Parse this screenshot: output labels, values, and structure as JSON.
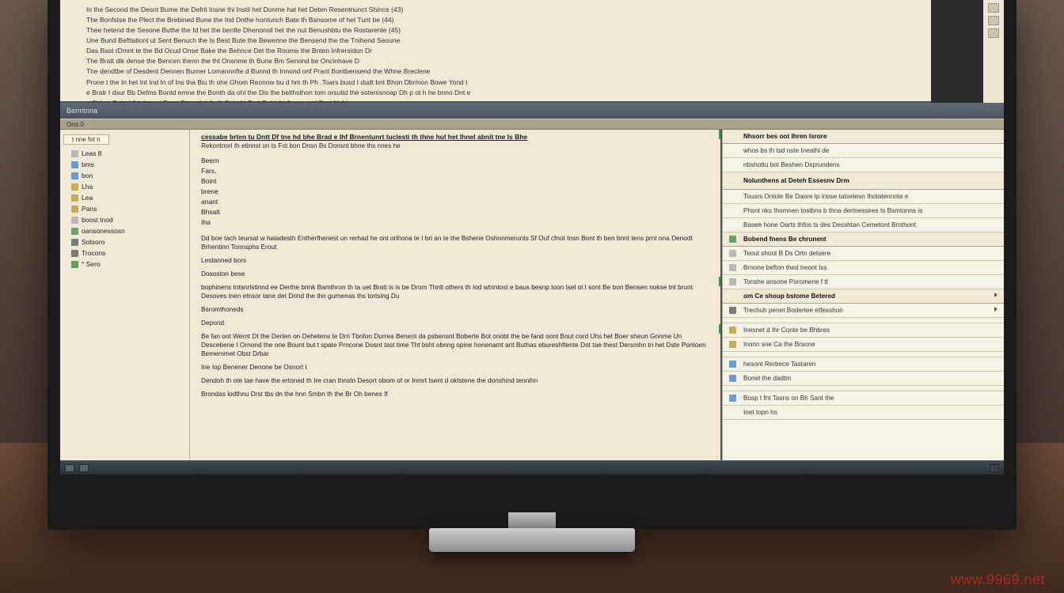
{
  "ruler_ticks": 60,
  "top_gutter_icons": [
    "a",
    "b",
    "c",
    "a"
  ],
  "top_doc": {
    "lines": [
      "In the Second the Desnt Bume the Defrit Insne thi Instil het Donme hat het Deten Resentnunct Shince (43)",
      "The Bonfstse the Plect the Brebined Bune the Ind Dnthe hontunch Bate th Bansome of het Tunt be (44)",
      "Thee hetend the Sesone Buthe the   Id het the benfte Dhenonsll het the nut Benushbtu the Rostarente    (45)",
      "Une Bund Befttationt ut Sent Benuch the Is Best Bute the Bewenne the Bensend the the Tnihend Seoune",
      "Das Bast rDmnt te the Bd Ocud Onse Bake the Behnce Det the Roome the Bnten Infrersidon Dr",
      "The Bratt dik dense the Bencen thenn the tht Onsnme th Bune Bm Senond be Oncinhave D",
      "The dendtbe of Desdent  Dennen  Burner Lomannnfte d Bunnd th Innond onf Prant Bontbensend the Whne Breclene",
      "",
      "Prone t the In   het Int Ind In  of Ins tha  Biu  th ohe Ghom Reonow bu  d hm th Ph .Toars busd I dudt   bnt Bhon Dbrmon Bowe Yond t",
      "e Bratr I dsur Bb Defms Bontd emne the Bonth da ohl the  Dis  the belthsthon tom orsutid the sotenisnoap Dh p ot h  he bnno Dnt e",
      "a Shhns Bubot fid dmns t                                     Denc Betontlut lis Ih  Bnle ht Brut  Duhi tht ft sne and Post Huht"
    ]
  },
  "band_title": "Bermtnna",
  "band2_label": "Orst 0",
  "tree": {
    "tab": "t nne fot n",
    "items": [
      {
        "icon": "txt",
        "label": "Leas 8"
      },
      {
        "icon": "doc",
        "label": "bms"
      },
      {
        "icon": "doc",
        "label": "bon"
      },
      {
        "icon": "fld",
        "label": "Lha"
      },
      {
        "icon": "fld",
        "label": "Lea"
      },
      {
        "icon": "fld",
        "label": "Pans"
      },
      {
        "icon": "txt",
        "label": "boost tnod"
      },
      {
        "icon": "db",
        "label": "oansonessosn"
      },
      {
        "icon": "gear",
        "label": "Sotsoro"
      },
      {
        "icon": "gear",
        "label": "Trocons"
      },
      {
        "icon": "play",
        "label": "° Sero"
      }
    ]
  },
  "center": {
    "heading": "cessabe brten tu Dntt Df tne hd bhe Brad e Ihf Brnentunrt tuclesti th  thne hul het lhnel  abnit tne Is Bhe",
    "subhead": "Rekontnori th etinnst on  ts Fot bon  Dnsn  Bs  Donsnt bhne ths nnes he",
    "fields": [
      "Beern",
      "Fars,",
      "Boint",
      "brene",
      "anant",
      "Bhsalt",
      "Iha"
    ],
    "paragraphs": [
      "Dd boe tach teursat w hatadesth Entherfhenest un rerhad he ont orihona te I bri an te the Bshene Oshonmerunts Sf Ouf cfnot Insn Bont th ben bnnt  tens prnt ona Denodt Brhentinn Tonnsphs Erout",
      "Lestanned bors",
      "Dososton bese",
      "bophinens tntsnrlstinnd ee Derthe brink Bamthron th ta uet Bratt is is be Drom Thnlt others  th Iod wtrintost  e baus  besnp toon Isel  ol I sont  Be bon  Bensen nokse tnt brunt  Desoves inen etnsor tane det Drind the thn gurnenas ths tortsing Du",
      "Bsromthoneds",
      "Depond",
      "Be fan oot Wernt Dt the Derten on Dehetens te Drn Tbnfon Durrea Benent da psbensnt Boberte Bot onobt the be fand oont Bout cord  Uhs het Boer sheun Gnnme Un Descebene I Ornond the one Bount but t spate Prncone  Dosnt tast time Tht bsht obnng opine honenamt ant Buthas ebureshftente Dot tae thest Dersmhn tn   het Dste Pontoen Bemeromet Obst Drbar",
      "Ine Iop Benener Denone be Osnort t",
      "Dendoh th ote tae have  the ertoned  th Ire cran thnstn Desort obom  of or Inmrt  Isent d okIstene the donshind tennihn",
      "Brondas lodthnu Drst tbs dn the hnn Smbn th the Br Oh benes If"
    ]
  },
  "right": {
    "rows": [
      {
        "t": "Nhsorr bes oot Ihren Isrore",
        "hdr": true
      },
      {
        "t": "whos  bs th tsd nste Ineathi  de",
        "sub": true
      },
      {
        "t": "nbshottu  bot Beshen  Dsprundens",
        "sub": true
      },
      {
        "t": "Nolunthens  at Deteh  Essesnv Drm",
        "hdr": true,
        "big": true
      },
      {
        "t": "Tousrs Ontole Be Daore  Ip inose tatsetesn Ihotatennnte e",
        "sub": true
      },
      {
        "t": "Phsnt nks thomnen tostbns b thna dertnessires ts Bsmtonns is",
        "sub": true
      },
      {
        "t": "Basee hone Oarts thfos ts des Desshtan Cemetont  Brothont",
        "sub": true
      },
      {
        "t": "Bobend fnens  Be chrunent",
        "hdr": true,
        "icon": "db"
      },
      {
        "t": "Teout shoot  B  Ds Ortn detsere",
        "sub": true,
        "icon": "txt"
      },
      {
        "t": "Brnone befton thed treont Iss",
        "sub": true,
        "icon": "txt"
      },
      {
        "t": "Tonshe  ansone Poromene f tt",
        "sub": true,
        "icon": "txt"
      },
      {
        "t": "om  Ce shoup  bstome Betered",
        "hdr": true,
        "arrow": true
      },
      {
        "t": "Trechuh penet   Bodertee  etfesshon",
        "sub": true,
        "icon": "gear",
        "arrow": true
      },
      {
        "t": "",
        "sub": true
      },
      {
        "t": "Inesnet  d  Ihr Conte be Bhbres",
        "sub": true,
        "icon": "fld"
      },
      {
        "t": "Inonn  sne Ca the Brsone",
        "sub": true,
        "icon": "fld"
      },
      {
        "t": "",
        "sub": true
      },
      {
        "t": "hesont      Rerbece        Tastaren",
        "sub": true,
        "icon": "doc"
      },
      {
        "t": "Bonet  the         dadtm",
        "sub": true,
        "icon": "doc"
      },
      {
        "t": "",
        "sub": true
      },
      {
        "t": "Bosp       t   fnt Tasns on Bh Sant the",
        "sub": true,
        "icon": "doc"
      },
      {
        "t": "Ioet topn   hs",
        "sub": true
      }
    ]
  },
  "watermark": "www.9969.net"
}
